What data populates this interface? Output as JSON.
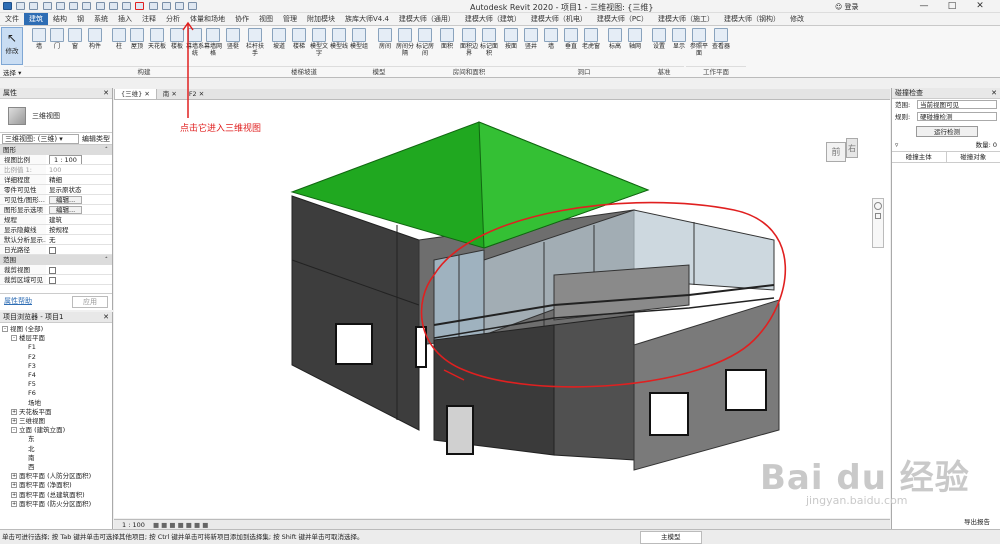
{
  "title": "Autodesk Revit 2020 - 项目1 - 三维视图: {三维}",
  "user": "登录",
  "tabs": [
    "文件",
    "建筑",
    "结构",
    "钢",
    "系统",
    "插入",
    "注释",
    "分析",
    "体量和场地",
    "协作",
    "视图",
    "管理",
    "附加模块",
    "族库大师V4.4",
    "建模大师（通用）",
    "建模大师（建筑）",
    "建模大师（机电）",
    "建模大师（PC）",
    "建模大师（施工）",
    "建模大师（钢构）",
    "修改"
  ],
  "active_tab": "建筑",
  "ribbon": {
    "modify": "修改",
    "select": "选择",
    "buttons": [
      "墙",
      "门",
      "窗",
      "构件",
      "柱",
      "屋顶",
      "天花板",
      "楼板",
      "幕墙系统",
      "幕墙网格",
      "竖梃",
      "栏杆扶手",
      "坡道",
      "楼梯",
      "模型文字",
      "模型线",
      "模型组",
      "房间",
      "房间分隔",
      "标记房间",
      "面积",
      "面积边界",
      "标记面积",
      "按面",
      "竖井",
      "墙",
      "垂直",
      "老虎窗",
      "标高",
      "轴网",
      "设置",
      "显示",
      "参照平面",
      "查看器"
    ],
    "groups": [
      "构建",
      "楼梯坡道",
      "模型",
      "房间和面积",
      "洞口",
      "基准",
      "工作平面"
    ]
  },
  "properties": {
    "header": "属性",
    "type_name": "三维视图",
    "selector": "三维视图: (三维)",
    "edit_type": "编辑类型",
    "category": "图形",
    "rows": [
      {
        "k": "视图比例",
        "v": "1 : 100",
        "box": true
      },
      {
        "k": "比例值 1:",
        "v": "100",
        "disabled": true
      },
      {
        "k": "详细程度",
        "v": "精细"
      },
      {
        "k": "零件可见性",
        "v": "显示原状态"
      },
      {
        "k": "可见性/图形...",
        "v": "编辑...",
        "btn": true
      },
      {
        "k": "图形显示选项",
        "v": "编辑...",
        "btn": true
      },
      {
        "k": "规程",
        "v": "建筑"
      },
      {
        "k": "显示隐藏线",
        "v": "按规程"
      },
      {
        "k": "默认分析显示...",
        "v": "无"
      },
      {
        "k": "日光路径",
        "v": "",
        "check": true
      }
    ],
    "category2": "范围",
    "rows2": [
      {
        "k": "裁剪视图",
        "v": "",
        "check": true
      },
      {
        "k": "裁剪区域可见",
        "v": "",
        "check": true
      }
    ],
    "help": "属性帮助",
    "apply": "应用"
  },
  "browser": {
    "header": "项目浏览器 - 项目1",
    "items": [
      {
        "t": "视图 (全部)",
        "d": 0,
        "tog": "-"
      },
      {
        "t": "楼层平面",
        "d": 1,
        "tog": "-"
      },
      {
        "t": "F1",
        "d": 2
      },
      {
        "t": "F2",
        "d": 2
      },
      {
        "t": "F3",
        "d": 2
      },
      {
        "t": "F4",
        "d": 2
      },
      {
        "t": "F5",
        "d": 2
      },
      {
        "t": "F6",
        "d": 2
      },
      {
        "t": "场地",
        "d": 2
      },
      {
        "t": "天花板平面",
        "d": 1,
        "tog": "+"
      },
      {
        "t": "三维视图",
        "d": 1,
        "tog": "+"
      },
      {
        "t": "立面 (建筑立面)",
        "d": 1,
        "tog": "-"
      },
      {
        "t": "东",
        "d": 2
      },
      {
        "t": "北",
        "d": 2
      },
      {
        "t": "南",
        "d": 2
      },
      {
        "t": "西",
        "d": 2
      },
      {
        "t": "面积平面 (人防分区面积)",
        "d": 1,
        "tog": "+"
      },
      {
        "t": "面积平面 (净面积)",
        "d": 1,
        "tog": "+"
      },
      {
        "t": "面积平面 (总建筑面积)",
        "d": 1,
        "tog": "+"
      },
      {
        "t": "面积平面 (防火分区面积)",
        "d": 1,
        "tog": "+"
      }
    ]
  },
  "view_tabs": [
    "{三维}",
    "南",
    "F2"
  ],
  "annotation": "点击它进入三维视图",
  "viewcube": {
    "front": "前",
    "right": "右"
  },
  "clash": {
    "header": "碰撞检查",
    "scope_label": "范围:",
    "scope_value": "当前视图可见",
    "rule_label": "规则:",
    "rule_value": "硬碰撞检测",
    "run": "运行检测",
    "count_label": "数量:",
    "count": "0",
    "col1": "碰撞主体",
    "col2": "碰撞对象"
  },
  "viewbar_scale": "1 : 100",
  "status_text": "单击可进行选择; 按 Tab 键并单击可选择其他项目; 按 Ctrl 键并单击可将新项目添加到选择集; 按 Shift 键并单击可取消选择。",
  "status_model": "主模型",
  "export_label": "导出报告",
  "watermark": "Bai du 经验",
  "watermark_url": "jingyan.baidu.com",
  "colors": {
    "accent": "#2e6db4",
    "roof": "#1fa51f",
    "annotation": "#e02020"
  }
}
